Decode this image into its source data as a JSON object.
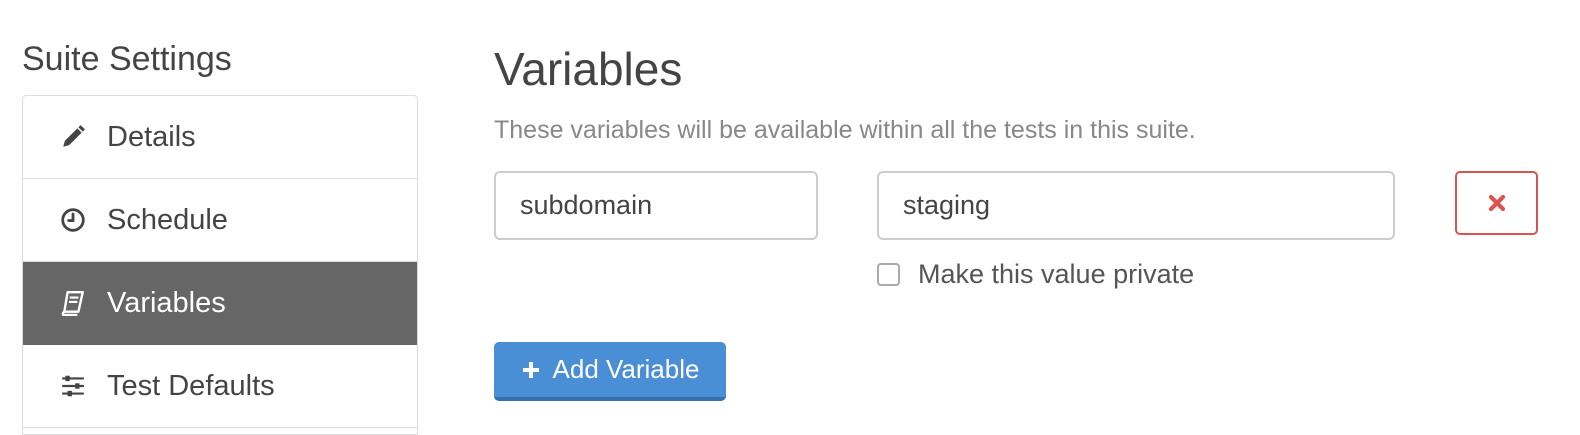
{
  "sidebar": {
    "title": "Suite Settings",
    "items": [
      {
        "label": "Details",
        "icon": "pencil-icon",
        "active": false
      },
      {
        "label": "Schedule",
        "icon": "clock-icon",
        "active": false
      },
      {
        "label": "Variables",
        "icon": "book-icon",
        "active": true
      },
      {
        "label": "Test Defaults",
        "icon": "sliders-icon",
        "active": false
      }
    ]
  },
  "main": {
    "heading": "Variables",
    "description": "These variables will be available within all the tests in this suite.",
    "variables": [
      {
        "name": "subdomain",
        "value": "staging",
        "private_label": "Make this value private",
        "private": false
      }
    ],
    "add_button_label": "Add Variable"
  },
  "colors": {
    "active_nav": "#666666",
    "primary_button": "#4a8fd6",
    "danger": "#d9534f"
  }
}
